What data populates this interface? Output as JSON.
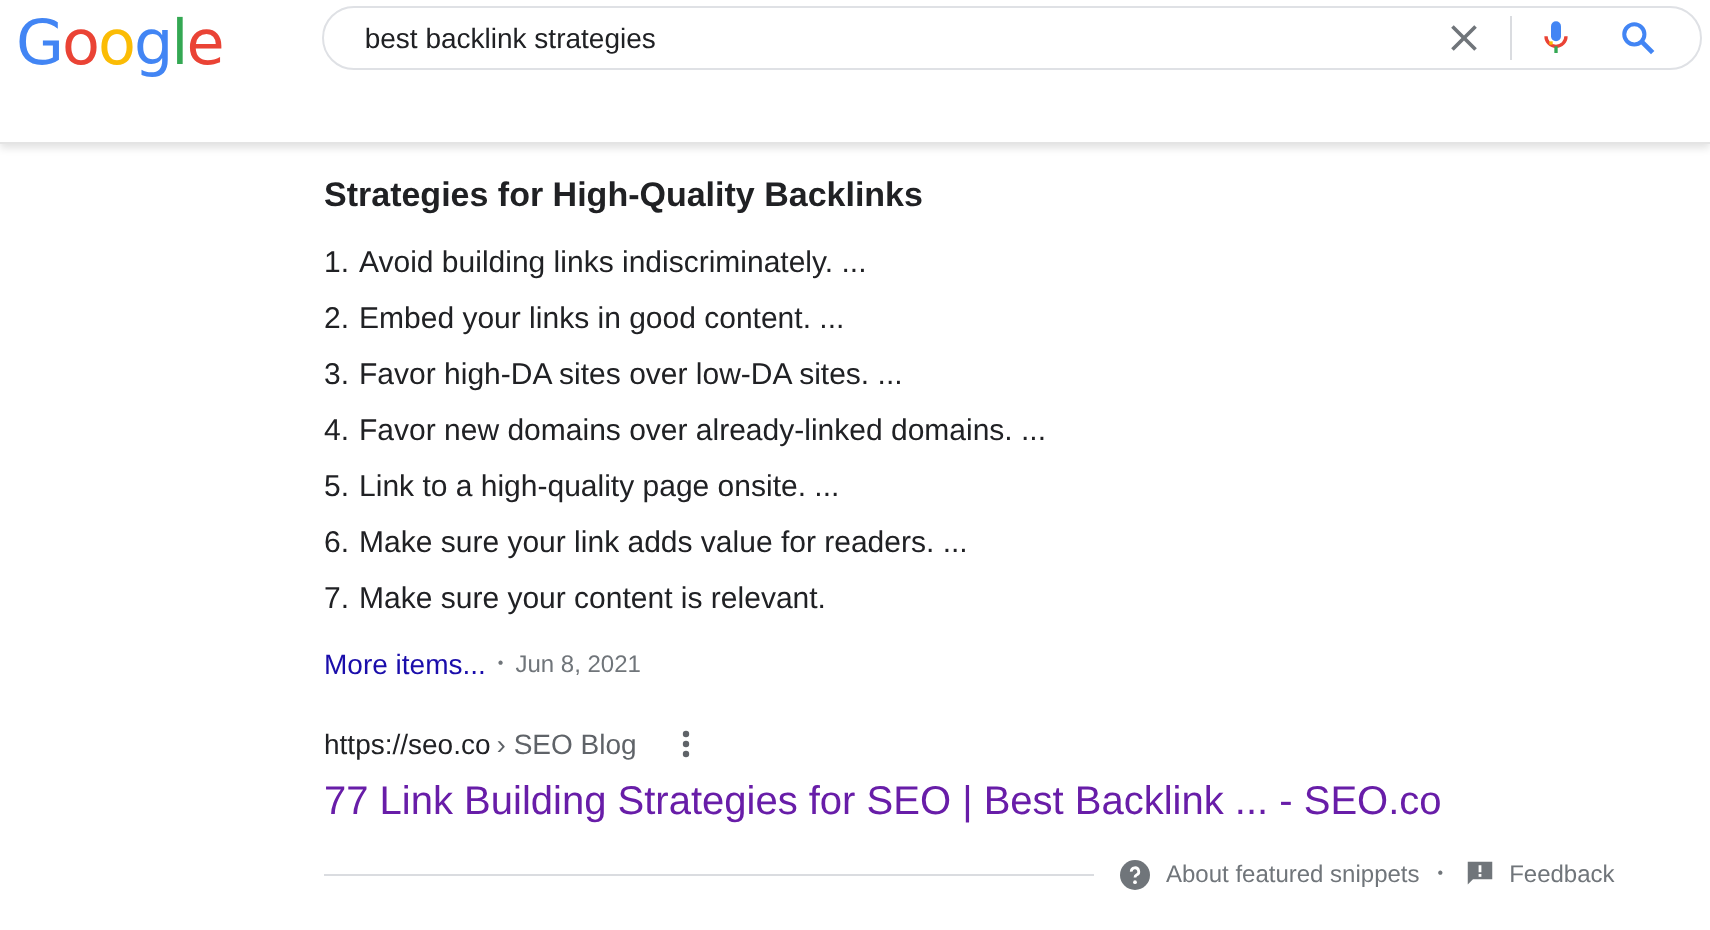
{
  "logo": {
    "letters": [
      {
        "char": "G",
        "color": "#4285f4"
      },
      {
        "char": "o",
        "color": "#ea4335"
      },
      {
        "char": "o",
        "color": "#fbbc05"
      },
      {
        "char": "g",
        "color": "#4285f4"
      },
      {
        "char": "l",
        "color": "#34a853"
      },
      {
        "char": "e",
        "color": "#ea4335"
      }
    ]
  },
  "search": {
    "value": "best backlink strategies"
  },
  "snippet": {
    "title": "Strategies for High-Quality Backlinks",
    "items": [
      {
        "number": "1.",
        "text": "Avoid building links indiscriminately. ..."
      },
      {
        "number": "2.",
        "text": "Embed your links in good content. ..."
      },
      {
        "number": "3.",
        "text": "Favor high-DA sites over low-DA sites. ..."
      },
      {
        "number": "4.",
        "text": "Favor new domains over already-linked domains. ..."
      },
      {
        "number": "5.",
        "text": "Link to a high-quality page onsite. ..."
      },
      {
        "number": "6.",
        "text": "Make sure your link adds value for readers. ..."
      },
      {
        "number": "7.",
        "text": "Make sure your content is relevant."
      }
    ],
    "more_link": "More items...",
    "separator": "•",
    "date": "Jun 8, 2021"
  },
  "result": {
    "url": "https://seo.co",
    "breadcrumb": "› SEO Blog",
    "title": "77 Link Building Strategies for SEO | Best Backlink ... - SEO.co"
  },
  "footer": {
    "about": "About featured snippets",
    "separator": "•",
    "feedback": "Feedback"
  }
}
